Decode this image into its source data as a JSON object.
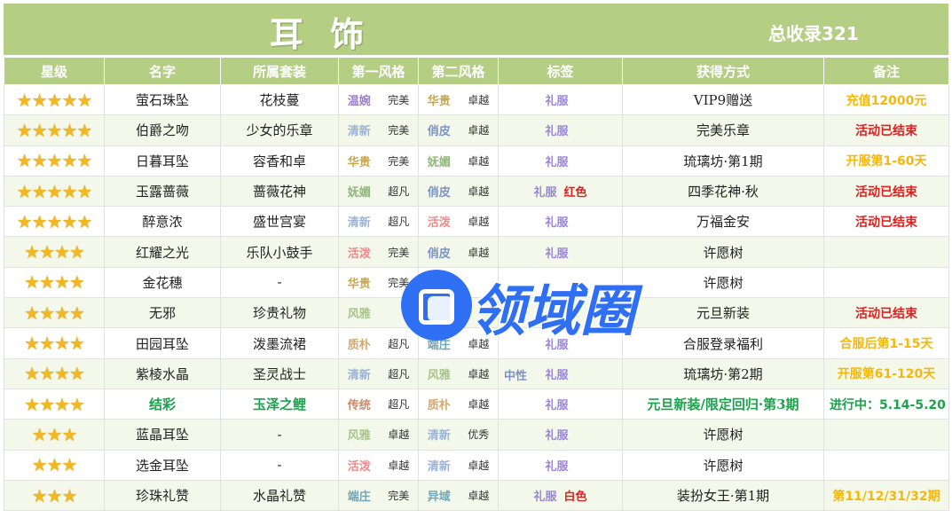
{
  "banner": {
    "title": "耳饰",
    "total": "总收录321"
  },
  "headers": [
    "星级",
    "名字",
    "所属套装",
    "第一风格",
    "第二风格",
    "标签",
    "获得方式",
    "备注"
  ],
  "watermark": {
    "text": "领域圈"
  },
  "colors": {
    "header_bg": "#b4ce84",
    "star": "#f2b822",
    "note_yellow": "#f5b70a",
    "note_red": "#e0201e",
    "note_green": "#1aa34a",
    "tag_purple": "#9a86d6"
  },
  "rows": [
    {
      "stars": "★★★★★",
      "name": "萤石珠坠",
      "suit": "花枝蔓",
      "s1": "温婉",
      "s1c": "#9b7fc7",
      "l1": "完美",
      "s2": "华贵",
      "s2c": "#c8a64a",
      "l2": "卓越",
      "tag_left": "",
      "tag": "礼服",
      "tag_extra": "",
      "tag_extra_c": "",
      "obtain": "VIP9赠送",
      "note": "充值12000元",
      "note_c": "#f5b70a",
      "green": false
    },
    {
      "stars": "★★★★★",
      "name": "伯爵之吻",
      "suit": "少女的乐章",
      "s1": "清新",
      "s1c": "#9cb4d4",
      "l1": "完美",
      "s2": "俏皮",
      "s2c": "#7d95c4",
      "l2": "卓越",
      "tag_left": "",
      "tag": "礼服",
      "tag_extra": "",
      "tag_extra_c": "",
      "obtain": "完美乐章",
      "note": "活动已结束",
      "note_c": "#e0201e",
      "green": false
    },
    {
      "stars": "★★★★★",
      "name": "日暮耳坠",
      "suit": "容香和卓",
      "s1": "华贵",
      "s1c": "#c8a64a",
      "l1": "完美",
      "s2": "妩媚",
      "s2c": "#8fb87a",
      "l2": "卓越",
      "tag_left": "",
      "tag": "礼服",
      "tag_extra": "",
      "tag_extra_c": "",
      "obtain": "琉璃坊·第1期",
      "note": "开服第1-60天",
      "note_c": "#f5b70a",
      "green": false
    },
    {
      "stars": "★★★★★",
      "name": "玉露蔷薇",
      "suit": "蔷薇花神",
      "s1": "妩媚",
      "s1c": "#8fb87a",
      "l1": "超凡",
      "s2": "俏皮",
      "s2c": "#7d95c4",
      "l2": "卓越",
      "tag_left": "",
      "tag": "礼服",
      "tag_extra": "红色",
      "tag_extra_c": "#e0201e",
      "obtain": "四季花神·秋",
      "note": "活动已结束",
      "note_c": "#e0201e",
      "green": false
    },
    {
      "stars": "★★★★★",
      "name": "醉意浓",
      "suit": "盛世宫宴",
      "s1": "清新",
      "s1c": "#9cb4d4",
      "l1": "超凡",
      "s2": "活泼",
      "s2c": "#f08a8a",
      "l2": "卓越",
      "tag_left": "",
      "tag": "礼服",
      "tag_extra": "",
      "tag_extra_c": "",
      "obtain": "万福金安",
      "note": "活动已结束",
      "note_c": "#e0201e",
      "green": false
    },
    {
      "stars": "★★★★",
      "name": "红耀之光",
      "suit": "乐队小鼓手",
      "s1": "活泼",
      "s1c": "#f08a8a",
      "l1": "完美",
      "s2": "俏皮",
      "s2c": "#7d95c4",
      "l2": "卓越",
      "tag_left": "",
      "tag": "礼服",
      "tag_extra": "",
      "tag_extra_c": "",
      "obtain": "许愿树",
      "note": "",
      "note_c": "",
      "green": false
    },
    {
      "stars": "★★★★",
      "name": "金花穗",
      "suit": "-",
      "s1": "华贵",
      "s1c": "#c8a64a",
      "l1": "完美",
      "s2": "",
      "s2c": "",
      "l2": "",
      "tag_left": "",
      "tag": "",
      "tag_extra": "",
      "tag_extra_c": "",
      "obtain": "许愿树",
      "note": "",
      "note_c": "",
      "green": false
    },
    {
      "stars": "★★★★",
      "name": "无邪",
      "suit": "珍贵礼物",
      "s1": "风雅",
      "s1c": "#a8c48c",
      "l1": "",
      "s2": "",
      "s2c": "",
      "l2": "",
      "tag_left": "",
      "tag": "",
      "tag_extra": "",
      "tag_extra_c": "",
      "obtain": "元旦新装",
      "note": "活动已结束",
      "note_c": "#e0201e",
      "green": false
    },
    {
      "stars": "★★★★",
      "name": "田园耳坠",
      "suit": "泼墨流裙",
      "s1": "质朴",
      "s1c": "#d4a870",
      "l1": "超凡",
      "s2": "端庄",
      "s2c": "#6fa7b8",
      "l2": "卓越",
      "tag_left": "",
      "tag": "礼服",
      "tag_extra": "",
      "tag_extra_c": "",
      "obtain": "合服登录福利",
      "note": "合服后第1-15天",
      "note_c": "#f5b70a",
      "green": false
    },
    {
      "stars": "★★★★",
      "name": "紫棱水晶",
      "suit": "圣灵战士",
      "s1": "清新",
      "s1c": "#9cb4d4",
      "l1": "超凡",
      "s2": "风雅",
      "s2c": "#a8c48c",
      "l2": "卓越",
      "tag_left": "中性",
      "tag": "礼服",
      "tag_extra": "",
      "tag_extra_c": "",
      "obtain": "琉璃坊·第2期",
      "note": "开服第61-120天",
      "note_c": "#f5b70a",
      "green": false
    },
    {
      "stars": "★★★★",
      "name": "结彩",
      "suit": "玉泽之鲤",
      "s1": "传统",
      "s1c": "#c98a6a",
      "l1": "超凡",
      "s2": "质朴",
      "s2c": "#d4a870",
      "l2": "卓越",
      "tag_left": "",
      "tag": "礼服",
      "tag_extra": "",
      "tag_extra_c": "",
      "obtain": "元旦新装/限定回归·第3期",
      "note": "进行中：5.14-5.20",
      "note_c": "#1aa34a",
      "green": true
    },
    {
      "stars": "★★★",
      "name": "蓝晶耳坠",
      "suit": "-",
      "s1": "风雅",
      "s1c": "#a8c48c",
      "l1": "卓越",
      "s2": "清新",
      "s2c": "#9cb4d4",
      "l2": "优秀",
      "tag_left": "",
      "tag": "礼服",
      "tag_extra": "",
      "tag_extra_c": "",
      "obtain": "许愿树",
      "note": "",
      "note_c": "",
      "green": false
    },
    {
      "stars": "★★★",
      "name": "选金耳坠",
      "suit": "-",
      "s1": "活泼",
      "s1c": "#f08a8a",
      "l1": "卓越",
      "s2": "清新",
      "s2c": "#9cb4d4",
      "l2": "卓越",
      "tag_left": "",
      "tag": "礼服",
      "tag_extra": "",
      "tag_extra_c": "",
      "obtain": "许愿树",
      "note": "",
      "note_c": "",
      "green": false
    },
    {
      "stars": "★★★",
      "name": "珍珠礼赞",
      "suit": "水晶礼赞",
      "s1": "端庄",
      "s1c": "#6fa7b8",
      "l1": "完美",
      "s2": "异域",
      "s2c": "#6fa7b8",
      "l2": "卓越",
      "tag_left": "",
      "tag": "礼服",
      "tag_extra": "白色",
      "tag_extra_c": "#e0201e",
      "obtain": "装扮女王·第1期",
      "note": "第11/12/31/32期",
      "note_c": "#f5b70a",
      "green": false
    }
  ]
}
